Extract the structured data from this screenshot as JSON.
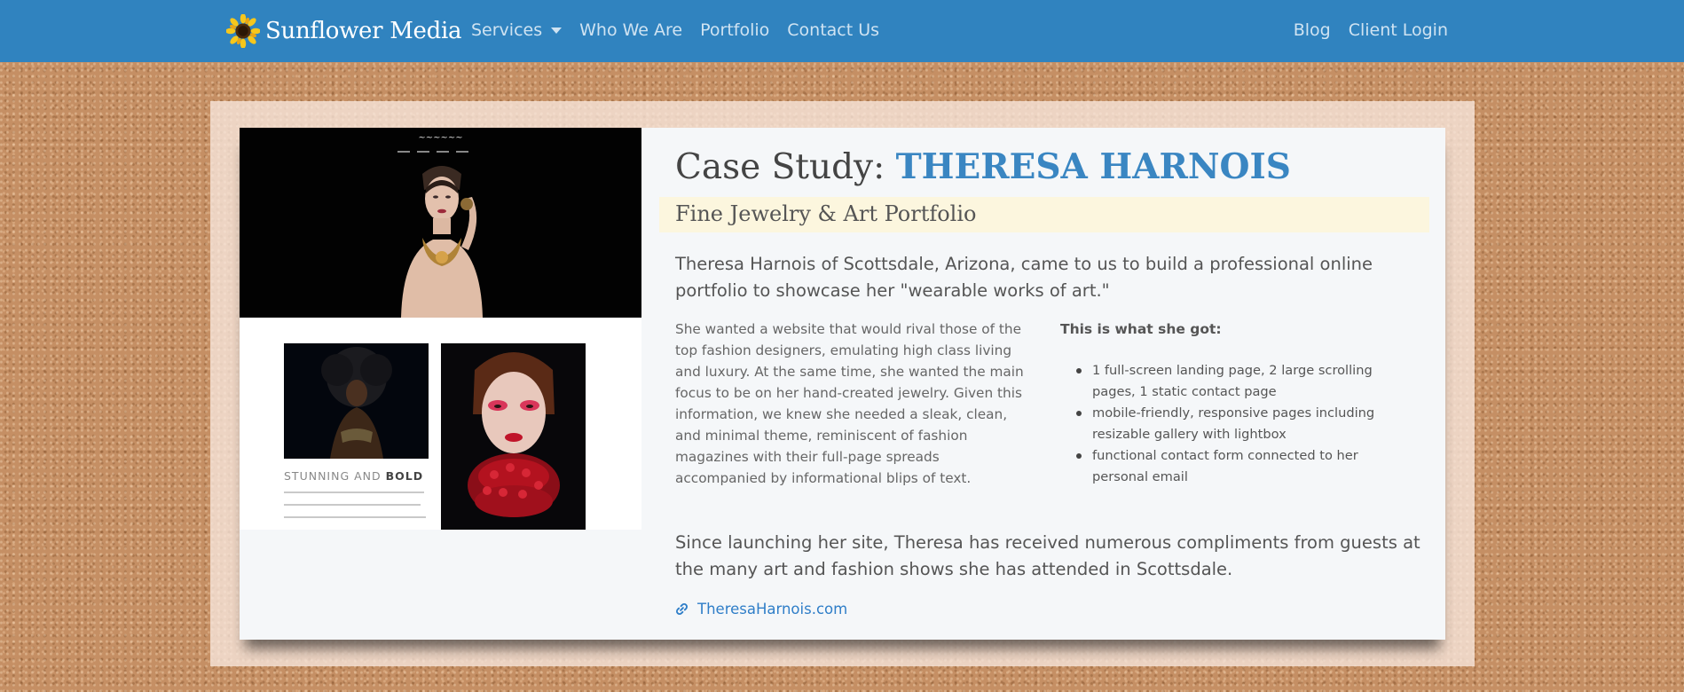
{
  "navbar": {
    "brand": "Sunflower Media",
    "left_items": [
      {
        "label": "Services",
        "has_dropdown": true
      },
      {
        "label": "Who We Are"
      },
      {
        "label": "Portfolio"
      },
      {
        "label": "Contact Us"
      }
    ],
    "right_items": [
      {
        "label": "Blog"
      },
      {
        "label": "Client Login"
      }
    ],
    "brand_color": "#3083bf"
  },
  "preview": {
    "stunning_label_light": "STUNNING AND ",
    "stunning_label_bold": "BOLD"
  },
  "case_study": {
    "title_prefix": "Case Study: ",
    "client_name": "THERESA HARNOIS",
    "subtitle": "Fine Jewelry & Art Portfolio",
    "lead": "Theresa Harnois of Scottsdale, Arizona, came to us to build a professional online portfolio to showcase her \"wearable works of art.\"",
    "body": "She wanted a website that would rival those of the top fashion designers, emulating high class living and luxury. At the same time, she wanted the main focus to be on her hand-created jewelry. Given this information, we knew she needed a sleak, clean, and minimal theme, reminiscent of fashion magazines with their full-page spreads accompanied by informational blips of text.",
    "got_title": "This is what she got:",
    "got_items": [
      "1 full-screen landing page, 2 large scrolling pages, 1 static contact page",
      "mobile-friendly, responsive pages including resizable gallery with lightbox",
      "functional contact form connected to her personal email"
    ],
    "closing": "Since launching her site, Theresa has received numerous compliments from guests at the many art and fashion shows she has attended in Scottsdale.",
    "link_text": "TheresaHarnois.com",
    "link_icon": "link-icon",
    "accent_color": "#3a86c2",
    "highlight_color": "#fcf6de"
  }
}
